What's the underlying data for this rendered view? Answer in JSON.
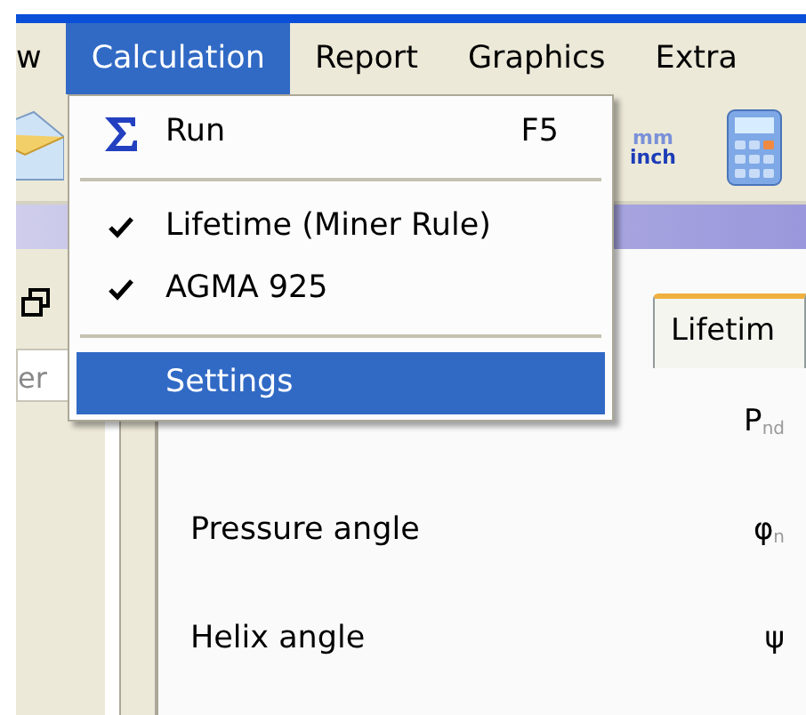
{
  "menu_bar": [
    {
      "label": "w",
      "selected": false
    },
    {
      "label": "Calculation",
      "selected": true
    },
    {
      "label": "Report",
      "selected": false
    },
    {
      "label": "Graphics",
      "selected": false
    },
    {
      "label": "Extra",
      "selected": false
    }
  ],
  "toolbar": [
    {
      "kind": "envelope"
    },
    {
      "kind": "units",
      "top": "mm",
      "bottom": "inch"
    },
    {
      "kind": "calculator"
    }
  ],
  "dropdown": [
    {
      "kind": "action",
      "label": "Run",
      "shortcut": "F5",
      "selected": false
    },
    {
      "kind": "separator"
    },
    {
      "kind": "check",
      "label": "Lifetime (Miner Rule)",
      "checked": true,
      "selected": false
    },
    {
      "kind": "check",
      "label": "AGMA 925",
      "checked": true,
      "selected": false
    },
    {
      "kind": "separator"
    },
    {
      "kind": "command",
      "label": "Settings",
      "selected": true
    }
  ],
  "left_panel": {
    "field_text": "er"
  },
  "tabs": [
    {
      "label": "Lifetim"
    }
  ],
  "parameters": [
    {
      "symbol": "P$_{nd}$"
    },
    {
      "label": "Pressure angle",
      "symbol": "φ$_{n}$"
    },
    {
      "label": "Helix angle",
      "symbol": "ψ"
    }
  ]
}
